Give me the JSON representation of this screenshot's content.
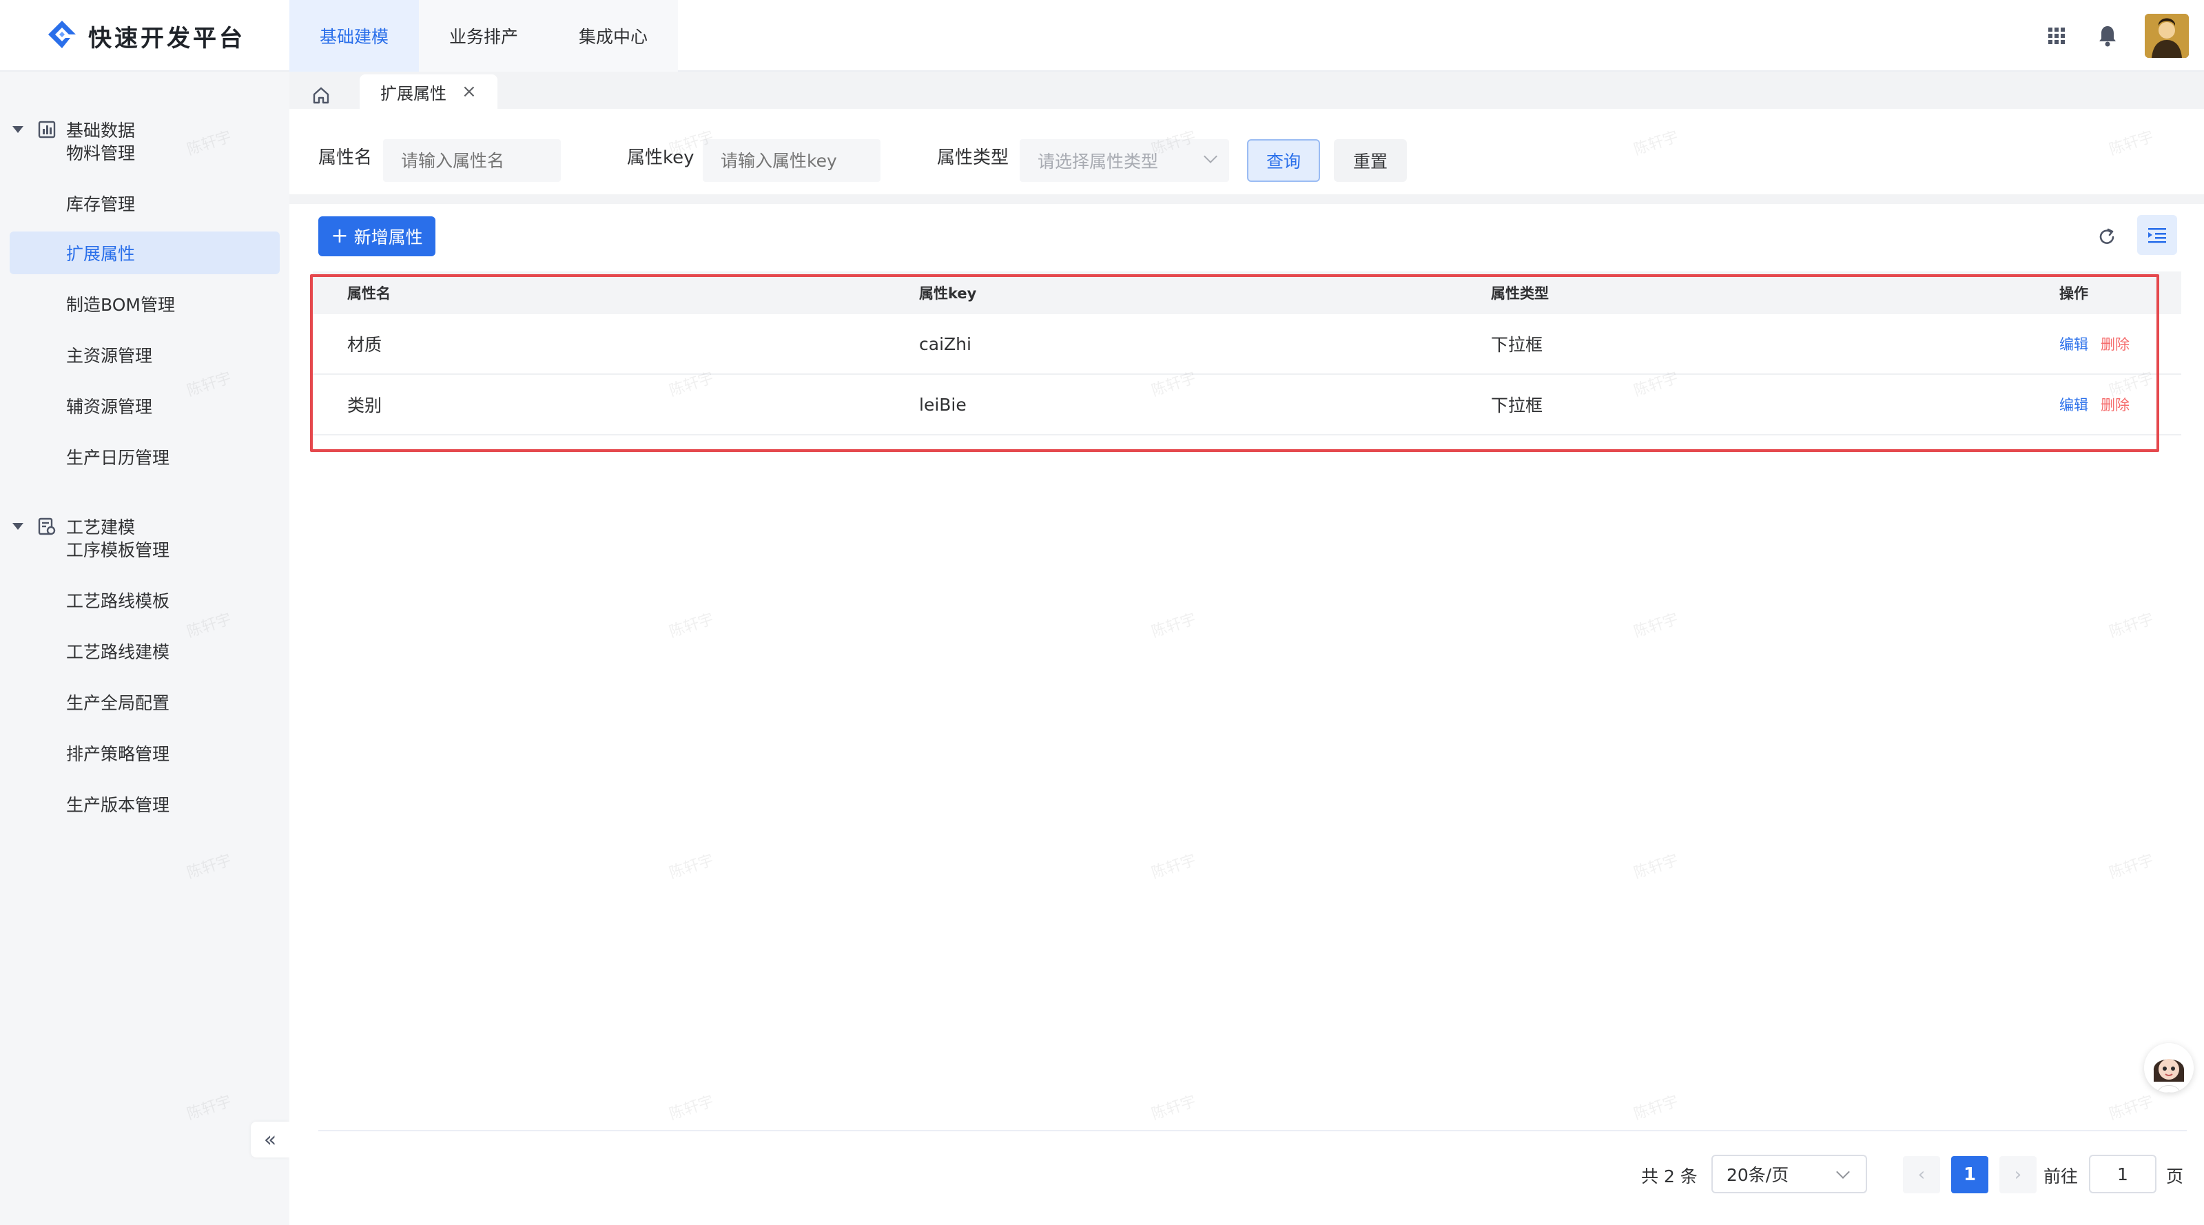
{
  "app": {
    "title": "快速开发平台"
  },
  "top_nav": [
    {
      "label": "基础建模",
      "active": true
    },
    {
      "label": "业务排产",
      "active": false
    },
    {
      "label": "集成中心",
      "active": false
    }
  ],
  "header_icons": [
    "apps-grid-icon",
    "bell-icon",
    "user-avatar"
  ],
  "sidebar": {
    "groups": [
      {
        "label": "基础数据",
        "icon": "chart-icon",
        "items": [
          {
            "label": "物料管理",
            "active": false
          },
          {
            "label": "库存管理",
            "active": false
          },
          {
            "label": "扩展属性",
            "active": true
          },
          {
            "label": "制造BOM管理",
            "active": false
          },
          {
            "label": "主资源管理",
            "active": false
          },
          {
            "label": "辅资源管理",
            "active": false
          },
          {
            "label": "生产日历管理",
            "active": false
          }
        ]
      },
      {
        "label": "工艺建模",
        "icon": "craft-icon",
        "items": [
          {
            "label": "工序模板管理",
            "active": false
          },
          {
            "label": "工艺路线模板",
            "active": false
          },
          {
            "label": "工艺路线建模",
            "active": false
          },
          {
            "label": "生产全局配置",
            "active": false
          },
          {
            "label": "排产策略管理",
            "active": false
          },
          {
            "label": "生产版本管理",
            "active": false
          }
        ]
      }
    ],
    "collapse_label": "«"
  },
  "tabs": {
    "current": "扩展属性",
    "close": "×"
  },
  "filter": {
    "name_label": "属性名",
    "name_placeholder": "请输入属性名",
    "key_label": "属性key",
    "key_placeholder": "请输入属性key",
    "type_label": "属性类型",
    "type_placeholder": "请选择属性类型",
    "query_label": "查询",
    "reset_label": "重置"
  },
  "toolbar": {
    "add_label": "新增属性"
  },
  "table": {
    "columns": [
      "属性名",
      "属性key",
      "属性类型",
      "操作"
    ],
    "rows": [
      {
        "name": "材质",
        "key": "caiZhi",
        "type": "下拉框",
        "edit": "编辑",
        "delete": "删除"
      },
      {
        "name": "类别",
        "key": "leiBie",
        "type": "下拉框",
        "edit": "编辑",
        "delete": "删除"
      }
    ]
  },
  "pagination": {
    "total": "共 2 条",
    "page_size": "20条/页",
    "current_page": "1",
    "goto_label": "前往",
    "goto_value": "1",
    "page_unit": "页"
  },
  "watermark": "陈轩宇",
  "colors": {
    "primary": "#2a6fea",
    "danger": "#f56c6c",
    "highlight_border": "#e5484d"
  }
}
